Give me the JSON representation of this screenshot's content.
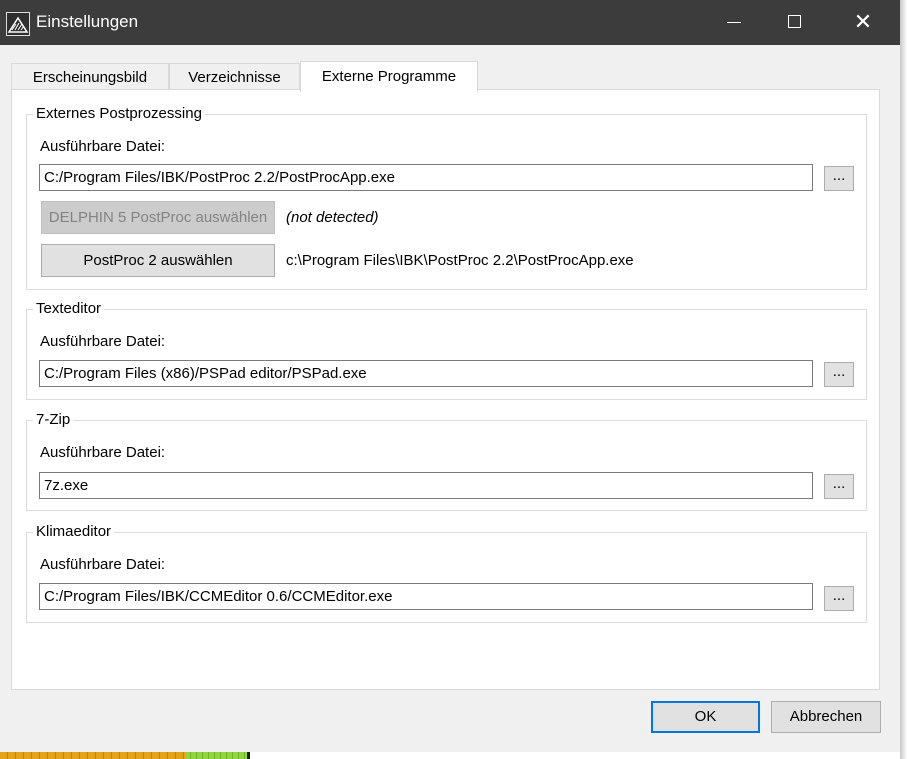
{
  "window": {
    "title": "Einstellungen"
  },
  "tabs": [
    {
      "label": "Erscheinungsbild"
    },
    {
      "label": "Verzeichnisse"
    },
    {
      "label": "Externe Programme"
    }
  ],
  "groups": {
    "postproc": {
      "title": "Externes Postprozessing",
      "exe_label": "Ausführbare Datei:",
      "exe_value": "C:/Program Files/IBK/PostProc 2.2/PostProcApp.exe",
      "d5_button": "DELPHIN 5 PostProc auswählen",
      "d5_status": "(not detected)",
      "pp2_button": "PostProc 2 auswählen",
      "pp2_path": "c:\\Program Files\\IBK\\PostProc 2.2\\PostProcApp.exe"
    },
    "texteditor": {
      "title": "Texteditor",
      "exe_label": "Ausführbare Datei:",
      "exe_value": "C:/Program Files (x86)/PSPad editor/PSPad.exe"
    },
    "zip": {
      "title": "7-Zip",
      "exe_label": "Ausführbare Datei:",
      "exe_value": "7z.exe"
    },
    "klima": {
      "title": "Klimaeditor",
      "exe_label": "Ausführbare Datei:",
      "exe_value": "C:/Program Files/IBK/CCMEditor 0.6/CCMEditor.exe"
    }
  },
  "browse_label": "...",
  "buttons": {
    "ok": "OK",
    "cancel": "Abbrechen"
  },
  "colors": {
    "titlebar": "#3c3c3c",
    "accent": "#0078d7"
  }
}
